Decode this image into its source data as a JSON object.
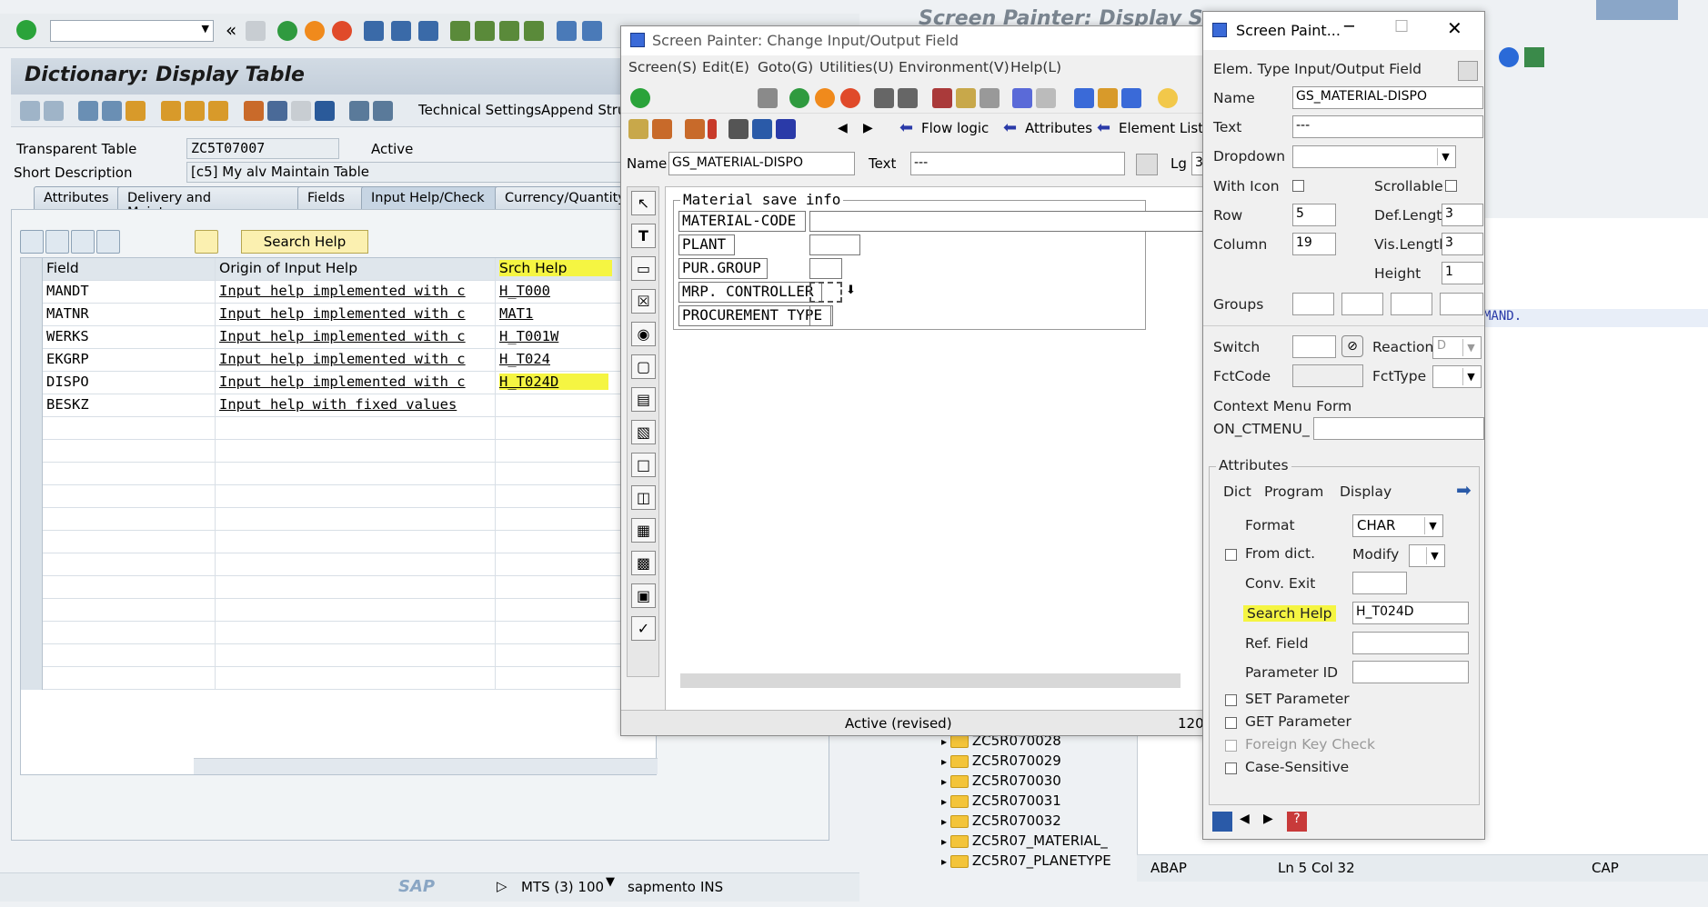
{
  "main": {
    "title": "Dictionary: Display Table",
    "toolbar": {
      "technical_settings": "Technical Settings",
      "append_structure": "Append Struc"
    },
    "transparent_table_label": "Transparent Table",
    "transparent_table_value": "ZC5T07007",
    "status": "Active",
    "short_desc_label": "Short Description",
    "short_desc_value": "[c5] My alv Maintain Table",
    "tabs": [
      "Attributes",
      "Delivery and Maintenance",
      "Fields",
      "Input Help/Check",
      "Currency/Quantity"
    ],
    "search_help_button": "Search Help",
    "grid": {
      "headers": [
        "Field",
        "Origin of Input Help",
        "Srch Help"
      ],
      "rows": [
        {
          "field": "MANDT",
          "origin": "Input help implemented with c",
          "srch": "H_T000"
        },
        {
          "field": "MATNR",
          "origin": "Input help implemented with c",
          "srch": "MAT1"
        },
        {
          "field": "WERKS",
          "origin": "Input help implemented with c",
          "srch": "H_T001W"
        },
        {
          "field": "EKGRP",
          "origin": "Input help implemented with c",
          "srch": "H_T024"
        },
        {
          "field": "DISPO",
          "origin": "Input help implemented with c",
          "srch": "H_T024D"
        },
        {
          "field": "BESKZ",
          "origin": "Input help with fixed values",
          "srch": ""
        }
      ]
    },
    "status_bar": {
      "system": "MTS (3) 100",
      "server": "sapmento",
      "mode": "INS",
      "logo": "SAP"
    }
  },
  "background": {
    "title": "Screen Painter: Display Scre",
    "code_fragment": "MAND.",
    "tree": [
      "ZC5R070028",
      "ZC5R070029",
      "ZC5R070030",
      "ZC5R070031",
      "ZC5R070032",
      "ZC5R07_MATERIAL_",
      "ZC5R07_PLANETYPE"
    ],
    "status": {
      "lang": "ABAP",
      "position": "Ln   5 Col  32",
      "caps": "CAP"
    }
  },
  "screen_painter": {
    "title": "Screen Painter:  Change Input/Output Field",
    "menu": [
      "Screen(S)",
      "Edit(E)",
      "Goto(G)",
      "Utilities(U)",
      "Environment(V)",
      "Help(L)"
    ],
    "nav": {
      "flow_logic": "Flow logic",
      "attributes": "Attributes",
      "element_list": "Element List"
    },
    "name_label": "Name",
    "name_value": "GS_MATERIAL-DISPO",
    "text_label": "Text",
    "text_value": "---",
    "lg_label": "Lg",
    "lg_value": "3",
    "frame_title": "Material save info",
    "fields": [
      "MATERIAL-CODE",
      "PLANT",
      "PUR.GROUP",
      "MRP. CONTROLLER",
      "PROCUREMENT TYPE"
    ],
    "status_text": "Active (revised)",
    "status_num": "120"
  },
  "attributes": {
    "title": "Screen Paint...",
    "elem_type": "Elem. Type Input/Output Field",
    "name_label": "Name",
    "name_value": "GS_MATERIAL-DISPO",
    "text_label": "Text",
    "text_value": "---",
    "dropdown_label": "Dropdown",
    "with_icon_label": "With Icon",
    "scrollable_label": "Scrollable",
    "row_label": "Row",
    "row_value": "5",
    "def_length_label": "Def.Lengtl",
    "def_length_value": "3",
    "column_label": "Column",
    "column_value": "19",
    "vis_length_label": "Vis.Lengtl",
    "vis_length_value": "3",
    "height_label": "Height",
    "height_value": "1",
    "groups_label": "Groups",
    "switch_label": "Switch",
    "reaction_label": "Reaction",
    "reaction_value": "D",
    "fctcode_label": "FctCode",
    "fcttype_label": "FctType",
    "context_menu_label": "Context Menu Form",
    "on_ctmenu_label": "ON_CTMENU_",
    "attributes_group": "Attributes",
    "subtabs": [
      "Dict",
      "Program",
      "Display"
    ],
    "format_label": "Format",
    "format_value": "CHAR",
    "from_dict_label": "From dict.",
    "modify_label": "Modify",
    "conv_exit_label": "Conv. Exit",
    "search_help_label": "Search Help",
    "search_help_value": "H_T024D",
    "ref_field_label": "Ref. Field",
    "parameter_id_label": "Parameter ID",
    "set_parameter_label": "SET Parameter",
    "get_parameter_label": "GET Parameter",
    "foreign_key_label": "Foreign Key Check",
    "case_sensitive_label": "Case-Sensitive"
  }
}
